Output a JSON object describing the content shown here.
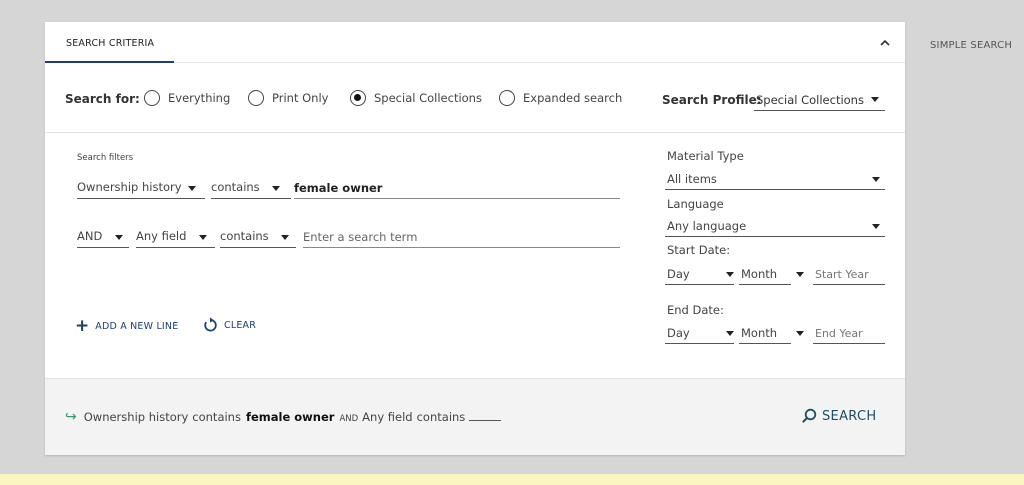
{
  "header": {
    "tab_label": "SEARCH CRITERIA",
    "simple_search_label": "SIMPLE SEARCH"
  },
  "search_for": {
    "label": "Search for:",
    "options": [
      {
        "label": "Everything",
        "checked": false
      },
      {
        "label": "Print Only",
        "checked": false
      },
      {
        "label": "Special Collections",
        "checked": true
      },
      {
        "label": "Expanded search",
        "checked": false
      }
    ],
    "profile_label": "Search Profile:",
    "profile_value": "Special Collections"
  },
  "filters": {
    "title": "Search filters",
    "lines": [
      {
        "field": "Ownership history",
        "condition": "contains",
        "value": "female owner",
        "placeholder": ""
      },
      {
        "operator": "AND",
        "field": "Any field",
        "condition": "contains",
        "value": "",
        "placeholder": "Enter a search term"
      }
    ],
    "add_line_label": "ADD A NEW LINE",
    "clear_label": "CLEAR"
  },
  "side": {
    "material_type_label": "Material Type",
    "material_type_value": "All items",
    "language_label": "Language",
    "language_value": "Any language",
    "start_date_label": "Start Date:",
    "end_date_label": "End Date:",
    "day_label": "Day",
    "month_label": "Month",
    "start_year_placeholder": "Start Year",
    "end_year_placeholder": "End Year"
  },
  "summary": {
    "field1": "Ownership history",
    "cond1": "contains",
    "value1": "female owner",
    "operator": "AND",
    "field2": "Any field",
    "cond2": "contains"
  },
  "search_button_label": "SEARCH",
  "icons": {
    "collapse": "chevron-up-icon",
    "add": "plus-icon",
    "clear": "refresh-icon",
    "search": "search-icon",
    "summary_arrow": "arrow-right-icon"
  },
  "colors": {
    "accent": "#1d3f72",
    "arrow": "#2e9b6b",
    "search_text": "#1d4f66",
    "background": "#d6d6d6",
    "bottom_strip": "#fbf5c2"
  }
}
